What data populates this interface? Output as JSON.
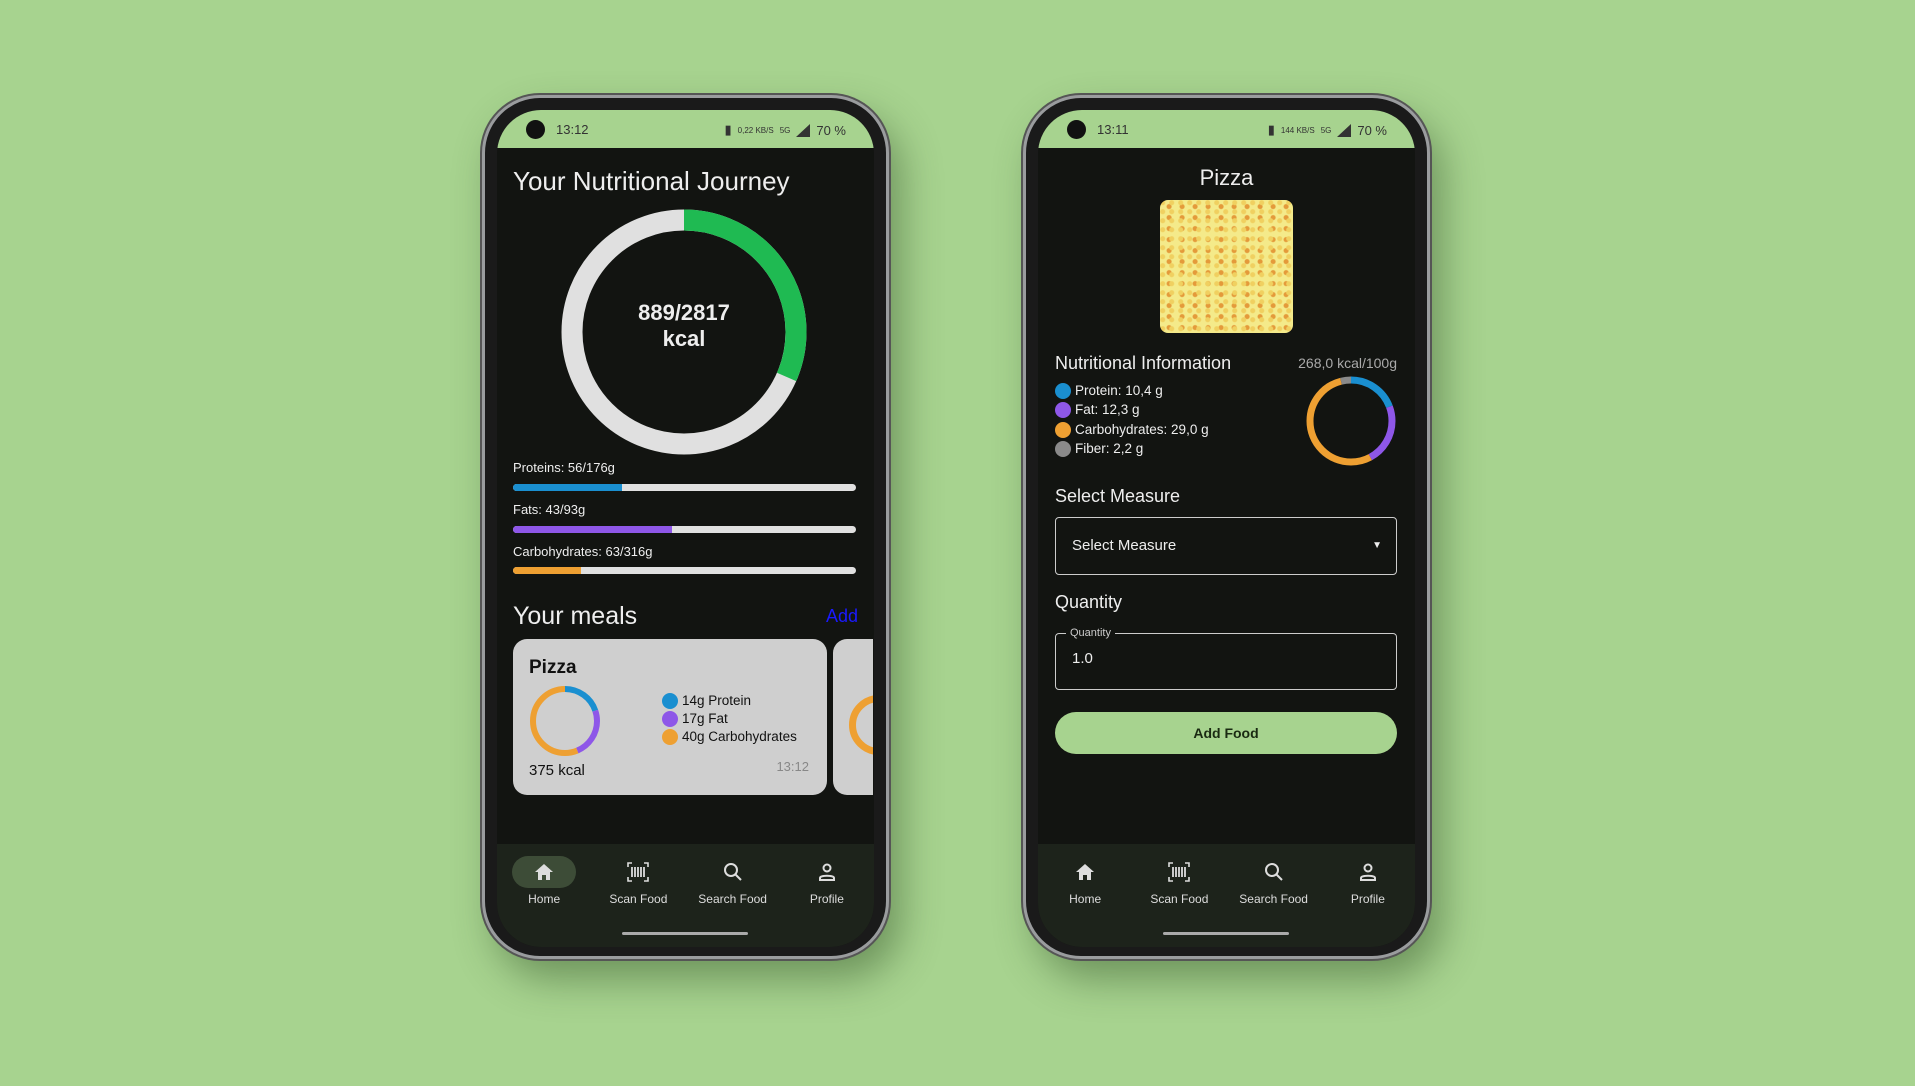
{
  "colors": {
    "protein": "#1a8fd0",
    "fat": "#8e57e8",
    "carbs": "#eea032",
    "fiber": "#8a8a8a",
    "progress": "#1fba52",
    "accent": "#a7d38f"
  },
  "nav": [
    {
      "label": "Home",
      "icon": "home-icon"
    },
    {
      "label": "Scan Food",
      "icon": "barcode-scan-icon"
    },
    {
      "label": "Search Food",
      "icon": "search-icon"
    },
    {
      "label": "Profile",
      "icon": "person-icon"
    }
  ],
  "home": {
    "status": {
      "time": "13:12",
      "speed": "0,22 KB/S",
      "network": "5G",
      "battery": "70 %"
    },
    "title": "Your Nutritional Journey",
    "calories": {
      "text": "889/2817",
      "unit": "kcal",
      "consumed": 889,
      "goal": 2817
    },
    "macros": [
      {
        "label": "Proteins: 56/176g",
        "value": 56,
        "goal": 176
      },
      {
        "label": "Fats: 43/93g",
        "value": 43,
        "goal": 93
      },
      {
        "label": "Carbohydrates: 63/316g",
        "value": 63,
        "goal": 316
      }
    ],
    "meals_title": "Your meals",
    "add_label": "Add",
    "meal": {
      "name": "Pizza",
      "kcal": "375 kcal",
      "time": "13:12",
      "protein": "14g Protein",
      "fat": "17g Fat",
      "carbs": "40g Carbohydrates",
      "values": [
        14,
        17,
        40
      ]
    }
  },
  "detail": {
    "status": {
      "time": "13:11",
      "speed": "144 KB/S",
      "network": "5G",
      "battery": "70 %"
    },
    "title": "Pizza",
    "nutri_title": "Nutritional Information",
    "kcal": "268,0 kcal/100g",
    "legend": [
      "Protein: 10,4 g",
      "Fat: 12,3 g",
      "Carbohydrates: 29,0 g",
      "Fiber: 2,2 g"
    ],
    "values": [
      10.4,
      12.3,
      29.0,
      2.2
    ],
    "measure_title": "Select Measure",
    "measure_placeholder": "Select Measure",
    "quantity_title": "Quantity",
    "quantity_label": "Quantity",
    "quantity_value": "1.0",
    "add_button": "Add Food"
  }
}
